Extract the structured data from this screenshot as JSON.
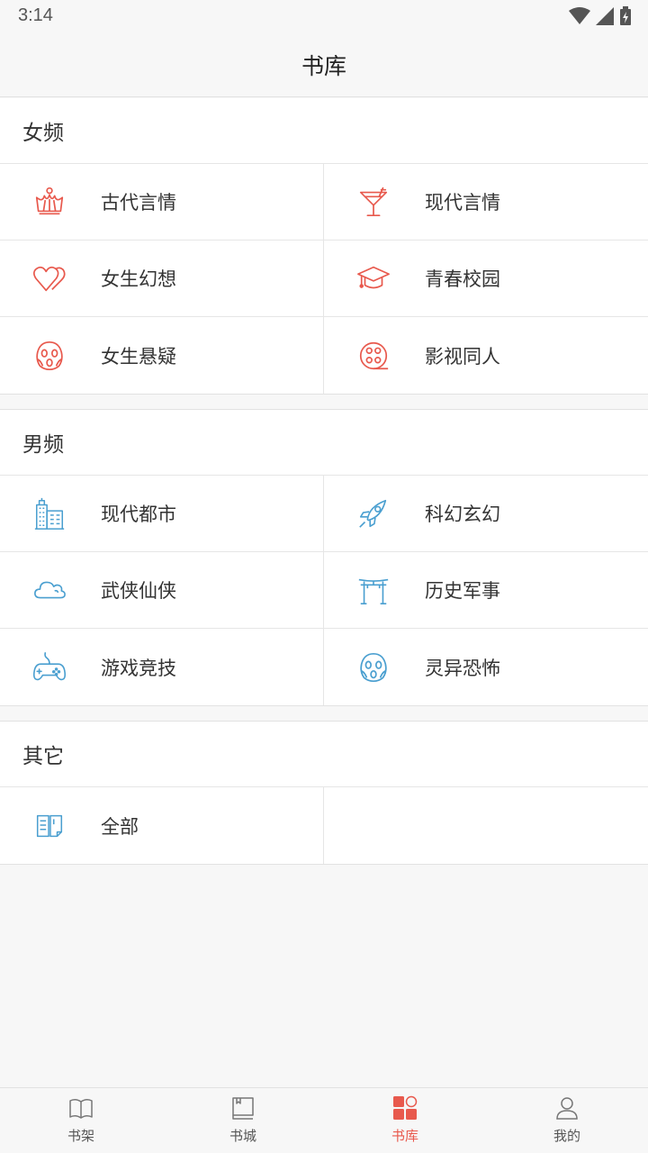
{
  "status": {
    "time": "3:14"
  },
  "header": {
    "title": "书库"
  },
  "sections": [
    {
      "title": "女频",
      "items": [
        {
          "label": "古代言情",
          "icon": "crown-icon"
        },
        {
          "label": "现代言情",
          "icon": "cocktail-icon"
        },
        {
          "label": "女生幻想",
          "icon": "hearts-icon"
        },
        {
          "label": "青春校园",
          "icon": "graduation-cap-icon"
        },
        {
          "label": "女生悬疑",
          "icon": "scream-face-icon"
        },
        {
          "label": "影视同人",
          "icon": "film-reel-icon"
        }
      ]
    },
    {
      "title": "男频",
      "items": [
        {
          "label": "现代都市",
          "icon": "buildings-icon"
        },
        {
          "label": "科幻玄幻",
          "icon": "rocket-icon"
        },
        {
          "label": "武侠仙侠",
          "icon": "cloud-icon"
        },
        {
          "label": "历史军事",
          "icon": "gate-icon"
        },
        {
          "label": "游戏竞技",
          "icon": "gamepad-icon"
        },
        {
          "label": "灵异恐怖",
          "icon": "scream-face-icon"
        }
      ]
    },
    {
      "title": "其它",
      "items": [
        {
          "label": "全部",
          "icon": "book-list-icon"
        }
      ]
    }
  ],
  "tabs": [
    {
      "label": "书架",
      "icon": "open-book-icon"
    },
    {
      "label": "书城",
      "icon": "bookstore-icon"
    },
    {
      "label": "书库",
      "icon": "library-grid-icon",
      "active": true
    },
    {
      "label": "我的",
      "icon": "user-icon"
    }
  ],
  "colors": {
    "female_accent": "#e8594d",
    "male_accent": "#4a9fd0",
    "active_tab": "#e8594d"
  }
}
